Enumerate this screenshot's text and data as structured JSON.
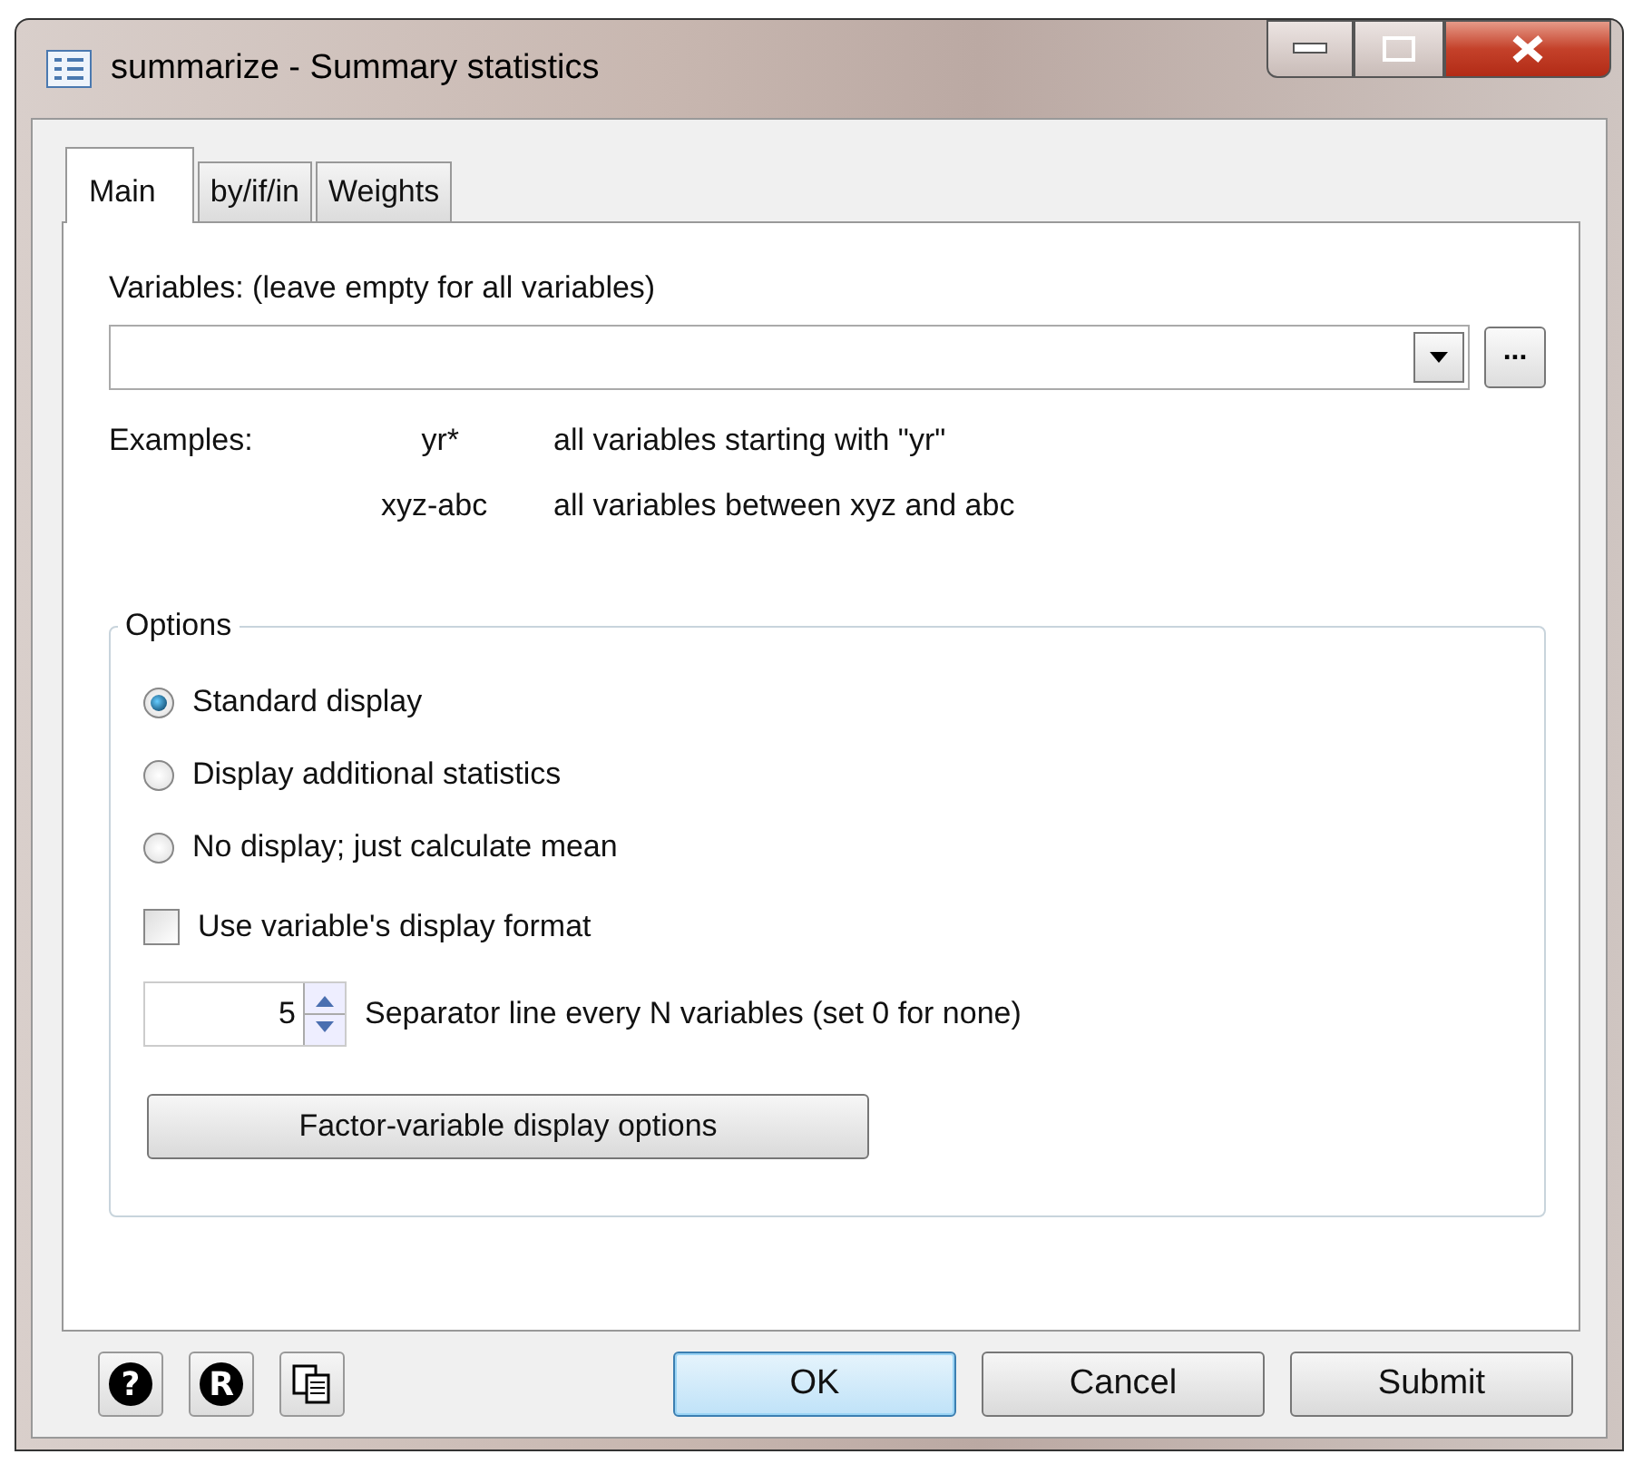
{
  "window": {
    "title": "summarize - Summary statistics"
  },
  "tabs": [
    {
      "label": "Main",
      "selected": true
    },
    {
      "label": "by/if/in",
      "selected": false
    },
    {
      "label": "Weights",
      "selected": false
    }
  ],
  "variables": {
    "label": "Variables: (leave empty for all variables)",
    "browse_button": "..."
  },
  "examples": {
    "label": "Examples:",
    "rows": [
      {
        "pattern": "yr*",
        "meaning": "all variables starting with \"yr\""
      },
      {
        "pattern": "xyz-abc",
        "meaning": "all variables between xyz and abc"
      }
    ]
  },
  "options": {
    "title": "Options",
    "radios": [
      {
        "label": "Standard display",
        "selected": true
      },
      {
        "label": "Display additional statistics",
        "selected": false
      },
      {
        "label": "No display; just calculate mean",
        "selected": false
      }
    ],
    "checkbox": {
      "label": "Use variable's display format",
      "checked": false
    },
    "separator": {
      "value": "5",
      "label": "Separator line every N variables (set 0 for none)"
    },
    "factor_button": "Factor-variable display options"
  },
  "footer": {
    "icon_buttons": [
      {
        "kind": "help",
        "glyph": "?"
      },
      {
        "kind": "reset",
        "glyph": "R"
      },
      {
        "kind": "copy"
      }
    ],
    "buttons": [
      {
        "label": "OK",
        "default": true
      },
      {
        "label": "Cancel",
        "default": false
      },
      {
        "label": "Submit",
        "default": false
      }
    ]
  }
}
